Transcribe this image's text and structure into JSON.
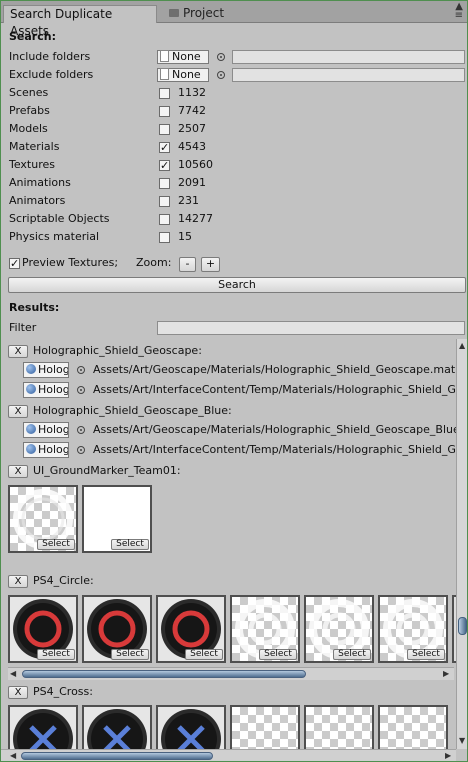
{
  "tabs": [
    {
      "label": "Search Duplicate Assets",
      "active": true
    },
    {
      "label": "Project",
      "active": false
    }
  ],
  "window_icons": {
    "top": "▲",
    "bottom": "≡"
  },
  "search": {
    "heading": "Search:",
    "include_label": "Include folders",
    "include_value": "None",
    "exclude_label": "Exclude folders",
    "exclude_value": "None",
    "types": [
      {
        "label": "Scenes",
        "count": "1132",
        "checked": false
      },
      {
        "label": "Prefabs",
        "count": "7742",
        "checked": false
      },
      {
        "label": "Models",
        "count": "2507",
        "checked": false
      },
      {
        "label": "Materials",
        "count": "4543",
        "checked": true
      },
      {
        "label": "Textures",
        "count": "10560",
        "checked": true
      },
      {
        "label": "Animations",
        "count": "2091",
        "checked": false
      },
      {
        "label": "Animators",
        "count": "231",
        "checked": false
      },
      {
        "label": "Scriptable Objects",
        "count": "14277",
        "checked": false
      },
      {
        "label": "Physics material",
        "count": "15",
        "checked": false
      }
    ],
    "preview_label": "Preview Textures;",
    "preview_checked": true,
    "zoom_label": "Zoom:",
    "zoom_minus": "-",
    "zoom_plus": "+",
    "search_button": "Search"
  },
  "results": {
    "heading": "Results:",
    "filter_label": "Filter",
    "remove_label": "X",
    "select_label": "Select",
    "groups": [
      {
        "name": "Holographic_Shield_Geoscape:",
        "items": [
          {
            "asset": "Holographic_Shield_Geoscape",
            "path": "Assets/Art/Geoscape/Materials/Holographic_Shield_Geoscape.mat"
          },
          {
            "asset": "Holographic_Shield_Geoscape",
            "path": "Assets/Art/InterfaceContent/Temp/Materials/Holographic_Shield_Geoscape.mat"
          }
        ]
      },
      {
        "name": "Holographic_Shield_Geoscape_Blue:",
        "items": [
          {
            "asset": "Holographic_Shield_Geoscape_Blue",
            "path": "Assets/Art/Geoscape/Materials/Holographic_Shield_Geoscape_Blue.mat"
          },
          {
            "asset": "Holographic_Shield_Geoscape_Blue",
            "path": "Assets/Art/InterfaceContent/Temp/Materials/Holographic_Shield_Geoscape_Blue.mat"
          }
        ]
      },
      {
        "name": "UI_GroundMarker_Team01:"
      },
      {
        "name": "PS4_Circle:"
      },
      {
        "name": "PS4_Cross:"
      }
    ]
  },
  "colors": {
    "panel": "#c2c2c2",
    "ps4_circle": "#d83a3a",
    "ps4_cross": "#5a7fd8",
    "scroll_thumb": "#5a7a9c"
  }
}
